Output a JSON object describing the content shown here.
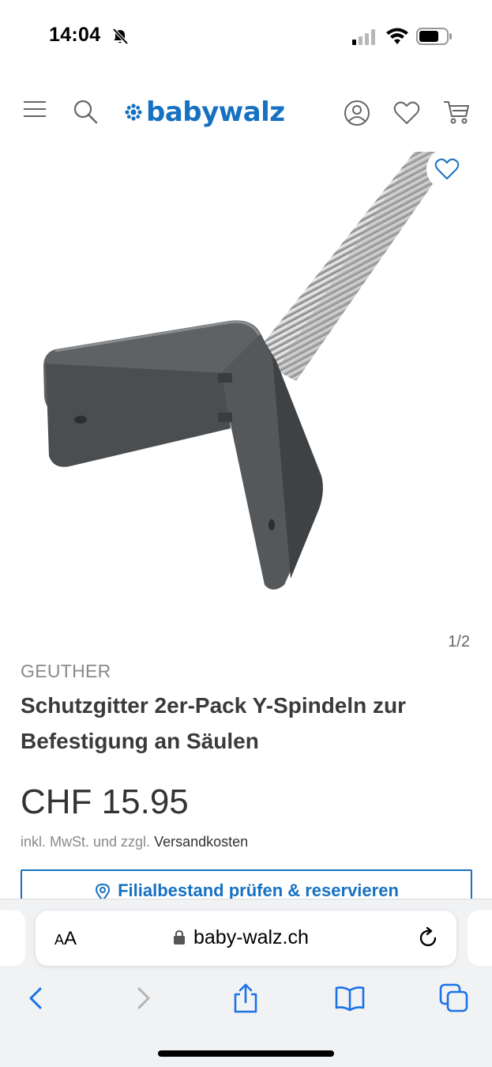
{
  "status_bar": {
    "time": "14:04"
  },
  "header": {
    "logo_text": "babywalz",
    "brand_color": "#1671c2",
    "icons": [
      "hamburger-menu-icon",
      "search-icon",
      "account-icon",
      "wishlist-heart-icon",
      "cart-icon"
    ]
  },
  "gallery": {
    "counter": "1/2"
  },
  "product": {
    "brand": "GEUTHER",
    "title": "Schutzgitter 2er-Pack Y-Spindeln zur Befestigung an Säulen",
    "price": "CHF 15.95",
    "tax_note": "inkl. MwSt. und zzgl.",
    "shipping_link": "Versandkosten",
    "stock_button": "Filialbestand prüfen & reservieren"
  },
  "browser": {
    "text_size_small": "A",
    "text_size_large": "A",
    "url": "baby-walz.ch",
    "icons": [
      "back-arrow-icon",
      "forward-arrow-icon",
      "share-icon",
      "bookmarks-icon",
      "tabs-icon"
    ]
  }
}
